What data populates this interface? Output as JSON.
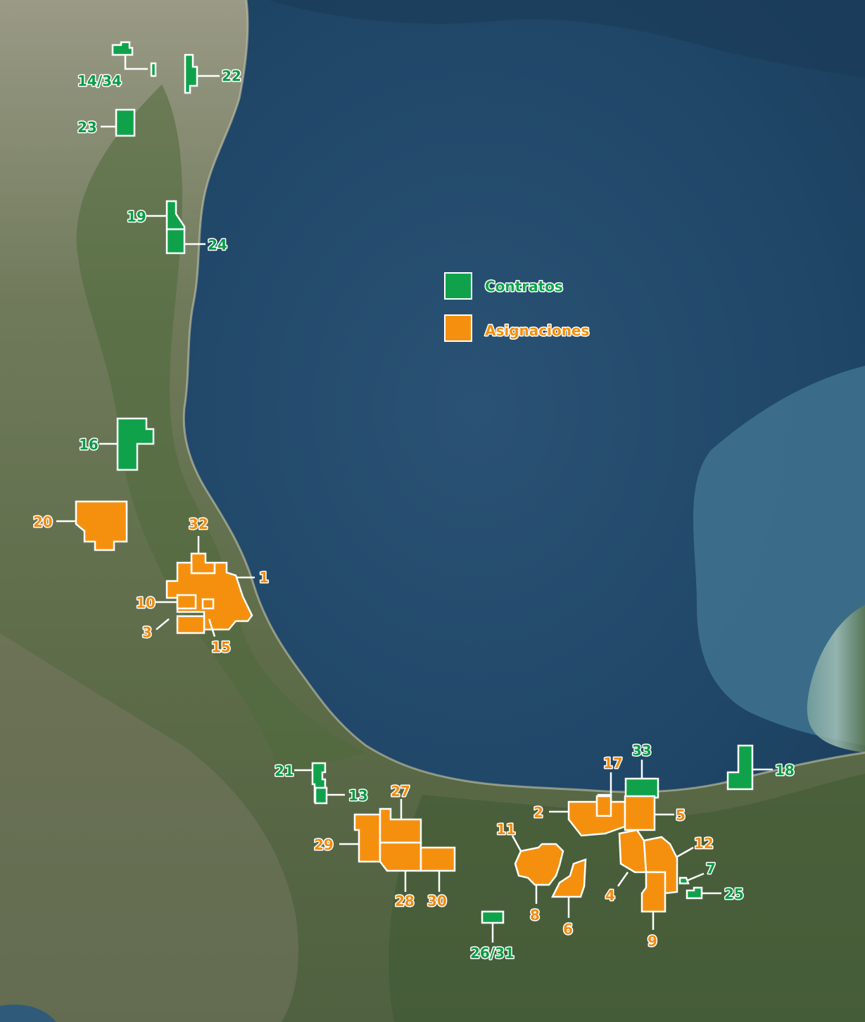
{
  "legend": {
    "contratos": {
      "label": "Contratos",
      "color": "#10a24b"
    },
    "asignaciones": {
      "label": "Asignaciones",
      "color": "#f5900f"
    }
  },
  "labels": {
    "l1434": "14/34",
    "l22": "22",
    "l23": "23",
    "l19": "19",
    "l24": "24",
    "l16": "16",
    "l20": "20",
    "l32": "32",
    "l1": "1",
    "l10": "10",
    "l3": "3",
    "l15": "15",
    "l21": "21",
    "l13": "13",
    "l27": "27",
    "l29": "29",
    "l28": "28",
    "l30": "30",
    "l11": "11",
    "l8": "8",
    "l6": "6",
    "l2631": "26/31",
    "l17": "17",
    "l33": "33",
    "l2": "2",
    "l5": "5",
    "l12": "12",
    "l4": "4",
    "l9": "9",
    "l7": "7",
    "l25": "25",
    "l18": "18"
  }
}
